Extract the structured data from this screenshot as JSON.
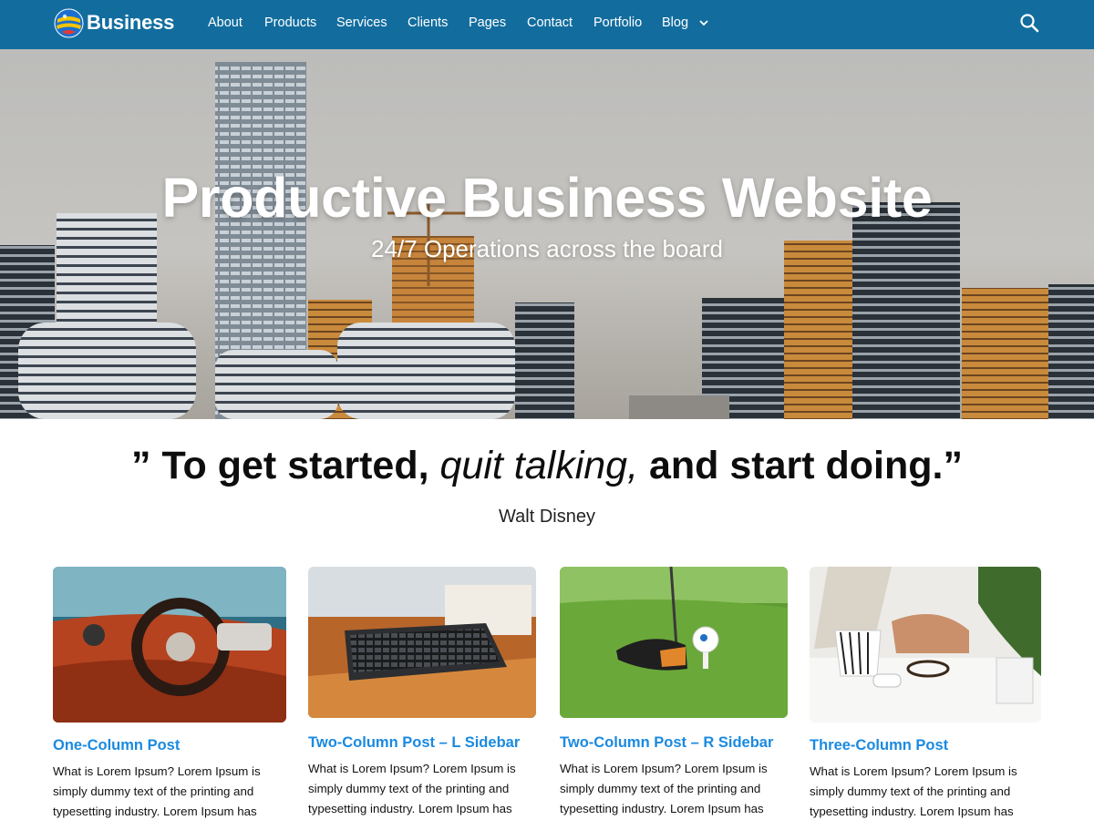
{
  "header": {
    "brand": "Business",
    "nav": [
      "About",
      "Products",
      "Services",
      "Clients",
      "Pages",
      "Contact",
      "Portfolio",
      "Blog"
    ],
    "accent_color": "#126d9e",
    "icons": [
      "logo-globe-icon",
      "chevron-down-icon",
      "search-icon"
    ]
  },
  "hero": {
    "title": "Productive Business Website",
    "subtitle": "24/7 Operations across the board"
  },
  "quote": {
    "open_mark": "”",
    "part1": "To get started,",
    "part2": "quit talking,",
    "part3": "and start doing.",
    "close_mark": "”",
    "author": "Walt Disney"
  },
  "posts": [
    {
      "title": "One-Column Post",
      "excerpt": "What is Lorem Ipsum? Lorem Ipsum is simply dummy text of the printing and typesetting industry. Lorem Ipsum has"
    },
    {
      "title": "Two-Column Post – L Sidebar",
      "excerpt": "What is Lorem Ipsum? Lorem Ipsum is simply dummy text of the printing and typesetting industry. Lorem Ipsum has"
    },
    {
      "title": "Two-Column Post – R Sidebar",
      "excerpt": "What is Lorem Ipsum? Lorem Ipsum is simply dummy text of the printing and typesetting industry. Lorem Ipsum has"
    },
    {
      "title": "Three-Column Post",
      "excerpt": "What is Lorem Ipsum? Lorem Ipsum is simply dummy text of the printing and typesetting industry. Lorem Ipsum has"
    }
  ],
  "link_color": "#1a8ae0"
}
